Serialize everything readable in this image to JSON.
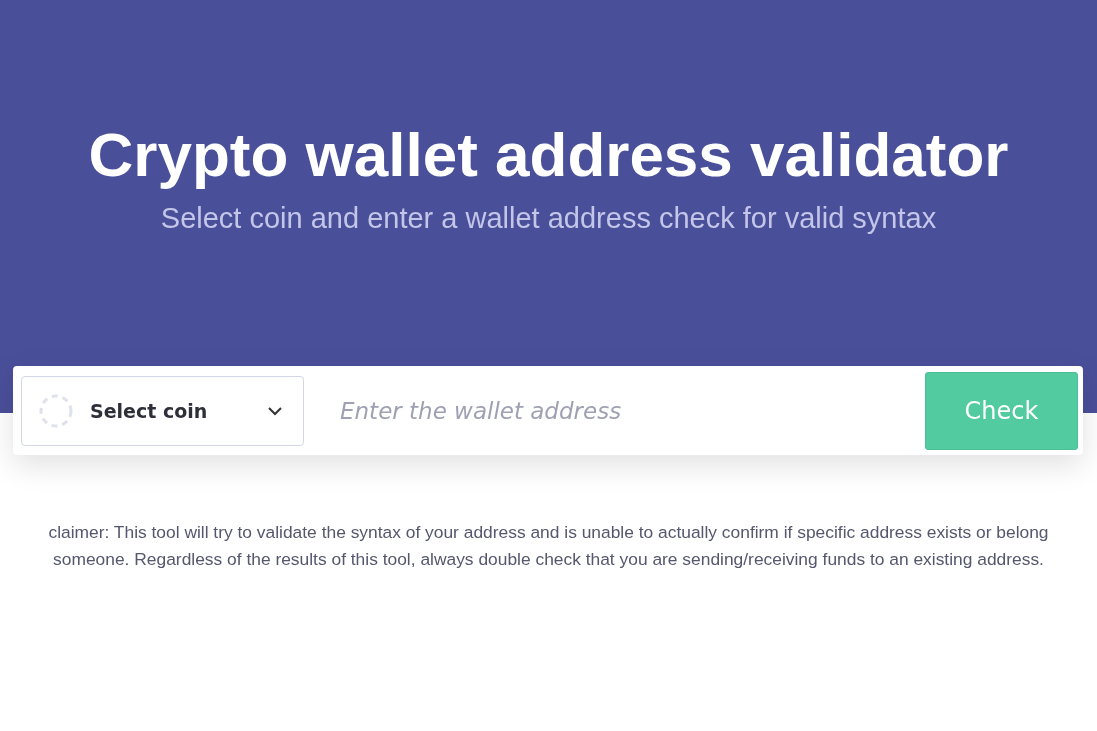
{
  "hero": {
    "title": "Crypto wallet address validator",
    "subtitle": "Select coin and enter a wallet address check for valid syntax"
  },
  "form": {
    "coin_select": {
      "label": "Select coin"
    },
    "address": {
      "placeholder": "Enter the wallet address"
    },
    "button": "Check"
  },
  "disclaimer": [
    "claimer: This tool will try to validate the syntax of your address and is unable to actually confirm if specific address exists or belong",
    "someone. Regardless of the results of this tool, always double check that you are sending/receiving funds to an existing address."
  ]
}
